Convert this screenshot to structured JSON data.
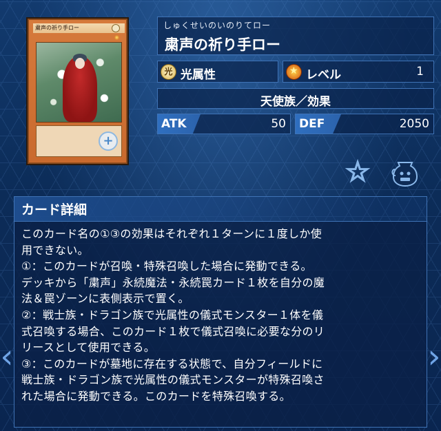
{
  "card_image": {
    "name_text": "粛声の祈り手ロー",
    "attribute_glyph": "光",
    "zoom_icon": "magnifier-plus-icon"
  },
  "card": {
    "ruby": "しゅくせいのいのりてロー",
    "name": "粛声の祈り手ロー",
    "attribute_label": "光属性",
    "attribute_icon_glyph": "光",
    "level_label": "レベル",
    "level_value": "1",
    "type_line": "天使族／効果",
    "atk_label": "ATK",
    "atk_value": "50",
    "def_label": "DEF",
    "def_value": "2050"
  },
  "actions": {
    "favorite_icon": "star-outline-icon",
    "deck_icon": "deck-jar-icon"
  },
  "detail": {
    "title": "カード詳細",
    "lines": [
      "このカード名の①③の効果はそれぞれ１ターンに１度しか使",
      "用できない。",
      "①：このカードが召喚・特殊召喚した場合に発動できる。",
      "デッキから「粛声」永続魔法・永続罠カード１枚を自分の魔",
      "法＆罠ゾーンに表側表示で置く。",
      "②：戦士族・ドラゴン族で光属性の儀式モンスター１体を儀",
      "式召喚する場合、このカード１枚で儀式召喚に必要な分のリ",
      "リースとして使用できる。",
      "③：このカードが墓地に存在する状態で、自分フィールドに",
      "戦士族・ドラゴン族で光属性の儀式モンスターが特殊召喚さ",
      "れた場合に発動できる。このカードを特殊召喚する。"
    ]
  },
  "nav": {
    "prev_glyph": "‹",
    "next_glyph": "›"
  },
  "colors": {
    "background": "#0b2a55",
    "panel_border": "#3f73b6",
    "accent_tag": "#2f6fc0",
    "card_frame": "#d67a3c"
  }
}
